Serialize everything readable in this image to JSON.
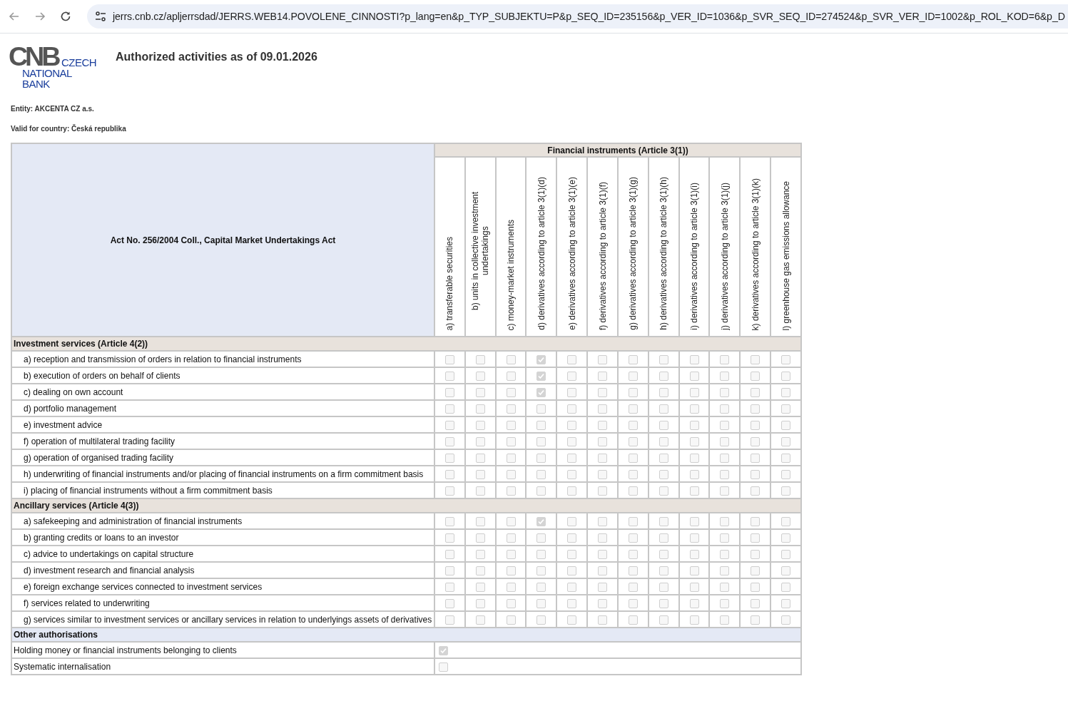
{
  "browser": {
    "url": "jerrs.cnb.cz/apljerrsdad/JERRS.WEB14.POVOLENE_CINNOSTI?p_lang=en&p_TYP_SUBJEKTU=P&p_SEQ_ID=235156&p_VER_ID=1036&p_SVR_SEQ_ID=274524&p_SVR_VER_ID=1002&p_ROL_KOD=6&p_D"
  },
  "logo": {
    "mark": "CNB",
    "lines": [
      "CZECH",
      "NATIONAL",
      "BANK"
    ]
  },
  "title": "Authorized activities as of 09.01.2026",
  "entity": "Entity: AKCENTA CZ a.s.",
  "country": "Valid for country: Česká republika",
  "table": {
    "corner_title": "Act No. 256/2004 Coll., Capital Market Undertakings Act",
    "group_title": "Financial instruments (Article 3(1))",
    "columns": [
      "a) transferable securities",
      "b) units in collective investment undertakings",
      "c) money-market instruments",
      "d) derivatives according to article 3(1)(d)",
      "e) derivatives according to article 3(1)(e)",
      "f) derivatives according to article 3(1)(f)",
      "g) derivatives according to article 3(1)(g)",
      "h) derivatives according to article 3(1)(h)",
      "i) derivatives according to article 3(1)(i)",
      "j) derivatives according to article 3(1)(j)",
      "k) derivatives according to article 3(1)(k)",
      "l) greenhouse gas emissions allowance"
    ],
    "sections": [
      {
        "title": "Investment services (Article 4(2))",
        "kind": "matrix",
        "rows": [
          {
            "label": "a) reception and transmission of orders in relation to financial instruments",
            "checked": [
              false,
              false,
              false,
              true,
              false,
              false,
              false,
              false,
              false,
              false,
              false,
              false
            ]
          },
          {
            "label": "b) execution of orders on behalf of clients",
            "checked": [
              false,
              false,
              false,
              true,
              false,
              false,
              false,
              false,
              false,
              false,
              false,
              false
            ]
          },
          {
            "label": "c) dealing on own account",
            "checked": [
              false,
              false,
              false,
              true,
              false,
              false,
              false,
              false,
              false,
              false,
              false,
              false
            ]
          },
          {
            "label": "d) portfolio management",
            "checked": [
              false,
              false,
              false,
              false,
              false,
              false,
              false,
              false,
              false,
              false,
              false,
              false
            ]
          },
          {
            "label": "e) investment advice",
            "checked": [
              false,
              false,
              false,
              false,
              false,
              false,
              false,
              false,
              false,
              false,
              false,
              false
            ]
          },
          {
            "label": "f) operation of multilateral trading facility",
            "checked": [
              false,
              false,
              false,
              false,
              false,
              false,
              false,
              false,
              false,
              false,
              false,
              false
            ]
          },
          {
            "label": "g) operation of organised trading facility",
            "checked": [
              false,
              false,
              false,
              false,
              false,
              false,
              false,
              false,
              false,
              false,
              false,
              false
            ]
          },
          {
            "label": "h) underwriting of financial instruments and/or placing of financial instruments on a firm commitment basis",
            "checked": [
              false,
              false,
              false,
              false,
              false,
              false,
              false,
              false,
              false,
              false,
              false,
              false
            ]
          },
          {
            "label": "i) placing of financial instruments without a firm commitment basis",
            "checked": [
              false,
              false,
              false,
              false,
              false,
              false,
              false,
              false,
              false,
              false,
              false,
              false
            ]
          }
        ]
      },
      {
        "title": "Ancillary services (Article 4(3))",
        "kind": "matrix",
        "rows": [
          {
            "label": "a) safekeeping and administration of financial instruments",
            "checked": [
              false,
              false,
              false,
              true,
              false,
              false,
              false,
              false,
              false,
              false,
              false,
              false
            ]
          },
          {
            "label": "b) granting credits or loans to an investor",
            "checked": [
              false,
              false,
              false,
              false,
              false,
              false,
              false,
              false,
              false,
              false,
              false,
              false
            ]
          },
          {
            "label": "c) advice to undertakings on capital structure",
            "checked": [
              false,
              false,
              false,
              false,
              false,
              false,
              false,
              false,
              false,
              false,
              false,
              false
            ]
          },
          {
            "label": "d) investment research and financial analysis",
            "checked": [
              false,
              false,
              false,
              false,
              false,
              false,
              false,
              false,
              false,
              false,
              false,
              false
            ]
          },
          {
            "label": "e) foreign exchange services connected to investment services",
            "checked": [
              false,
              false,
              false,
              false,
              false,
              false,
              false,
              false,
              false,
              false,
              false,
              false
            ]
          },
          {
            "label": "f) services related to underwriting",
            "checked": [
              false,
              false,
              false,
              false,
              false,
              false,
              false,
              false,
              false,
              false,
              false,
              false
            ]
          },
          {
            "label": "g) services similar to investment services or ancillary services in relation to underlyings assets of derivatives",
            "checked": [
              false,
              false,
              false,
              false,
              false,
              false,
              false,
              false,
              false,
              false,
              false,
              false
            ]
          }
        ]
      },
      {
        "title": "Other authorisations",
        "kind": "single",
        "rows": [
          {
            "label": "Holding money or financial instruments belonging to clients",
            "checked": true
          },
          {
            "label": "Systematic internalisation",
            "checked": false
          }
        ]
      }
    ]
  }
}
